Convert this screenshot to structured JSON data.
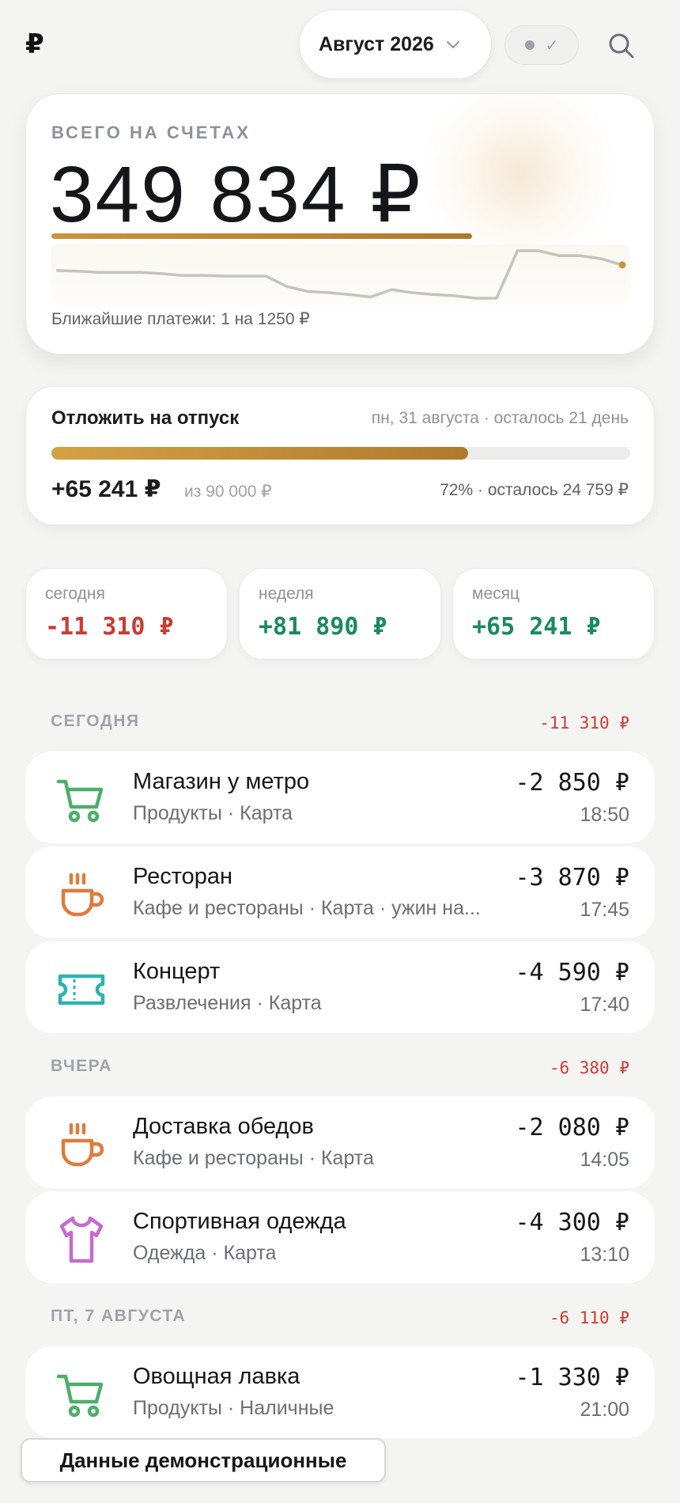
{
  "header": {
    "logo": "₽",
    "month_label": "Август 2026",
    "status_check": "✓"
  },
  "balance": {
    "label": "ВСЕГО НА СЧЕТАХ",
    "amount": "349 834 ₽",
    "upcoming": "Ближайшие платежи: 1 на 1250 ₽",
    "trend": [
      0.88,
      0.87,
      0.85,
      0.85,
      0.85,
      0.83,
      0.8,
      0.8,
      0.79,
      0.79,
      0.79,
      0.62,
      0.54,
      0.52,
      0.49,
      0.45,
      0.57,
      0.52,
      0.49,
      0.47,
      0.43,
      0.43,
      1.2,
      1.2,
      1.12,
      1.12,
      1.07,
      0.97
    ]
  },
  "goal": {
    "title": "Отложить на отпуск",
    "date_info": "пн, 31 августа · осталось 21 день",
    "saved": "+65 241 ₽",
    "target": "из 90 000 ₽",
    "progress_text": "72% · осталось 24 759 ₽",
    "progress": 0.72
  },
  "stats": [
    {
      "label": "сегодня",
      "value": "-11 310 ₽",
      "tone": "neg"
    },
    {
      "label": "неделя",
      "value": "+81 890 ₽",
      "tone": "pos"
    },
    {
      "label": "месяц",
      "value": "+65 241 ₽",
      "tone": "pos"
    }
  ],
  "sections": [
    {
      "title": "СЕГОДНЯ",
      "total": "-11 310 ₽",
      "items": [
        {
          "name": "Магазин у метро",
          "meta": "Продукты · Карта",
          "amount": "-2 850 ₽",
          "time": "18:50",
          "icon": "cart-icon",
          "color": "#4caf6a"
        },
        {
          "name": "Ресторан",
          "meta": "Кафе и рестораны · Карта · ужин на...",
          "amount": "-3 870 ₽",
          "time": "17:45",
          "icon": "coffee-cup-icon",
          "color": "#e07b3c"
        },
        {
          "name": "Концерт",
          "meta": "Развлечения · Карта",
          "amount": "-4 590 ₽",
          "time": "17:40",
          "icon": "ticket-icon",
          "color": "#2ab3b0"
        }
      ]
    },
    {
      "title": "ВЧЕРА",
      "total": "-6 380 ₽",
      "items": [
        {
          "name": "Доставка обедов",
          "meta": "Кафе и рестораны · Карта",
          "amount": "-2 080 ₽",
          "time": "14:05",
          "icon": "coffee-cup-icon",
          "color": "#e07b3c"
        },
        {
          "name": "Спортивная одежда",
          "meta": "Одежда · Карта",
          "amount": "-4 300 ₽",
          "time": "13:10",
          "icon": "tshirt-icon",
          "color": "#c66ad0"
        }
      ]
    },
    {
      "title": "ПТ, 7 АВГУСТА",
      "total": "-6 110 ₽",
      "items": [
        {
          "name": "Овощная лавка",
          "meta": "Продукты · Наличные",
          "amount": "-1 330 ₽",
          "time": "21:00",
          "icon": "cart-icon",
          "color": "#4caf6a"
        }
      ]
    }
  ],
  "demo_badge": "Данные демонстрационные"
}
